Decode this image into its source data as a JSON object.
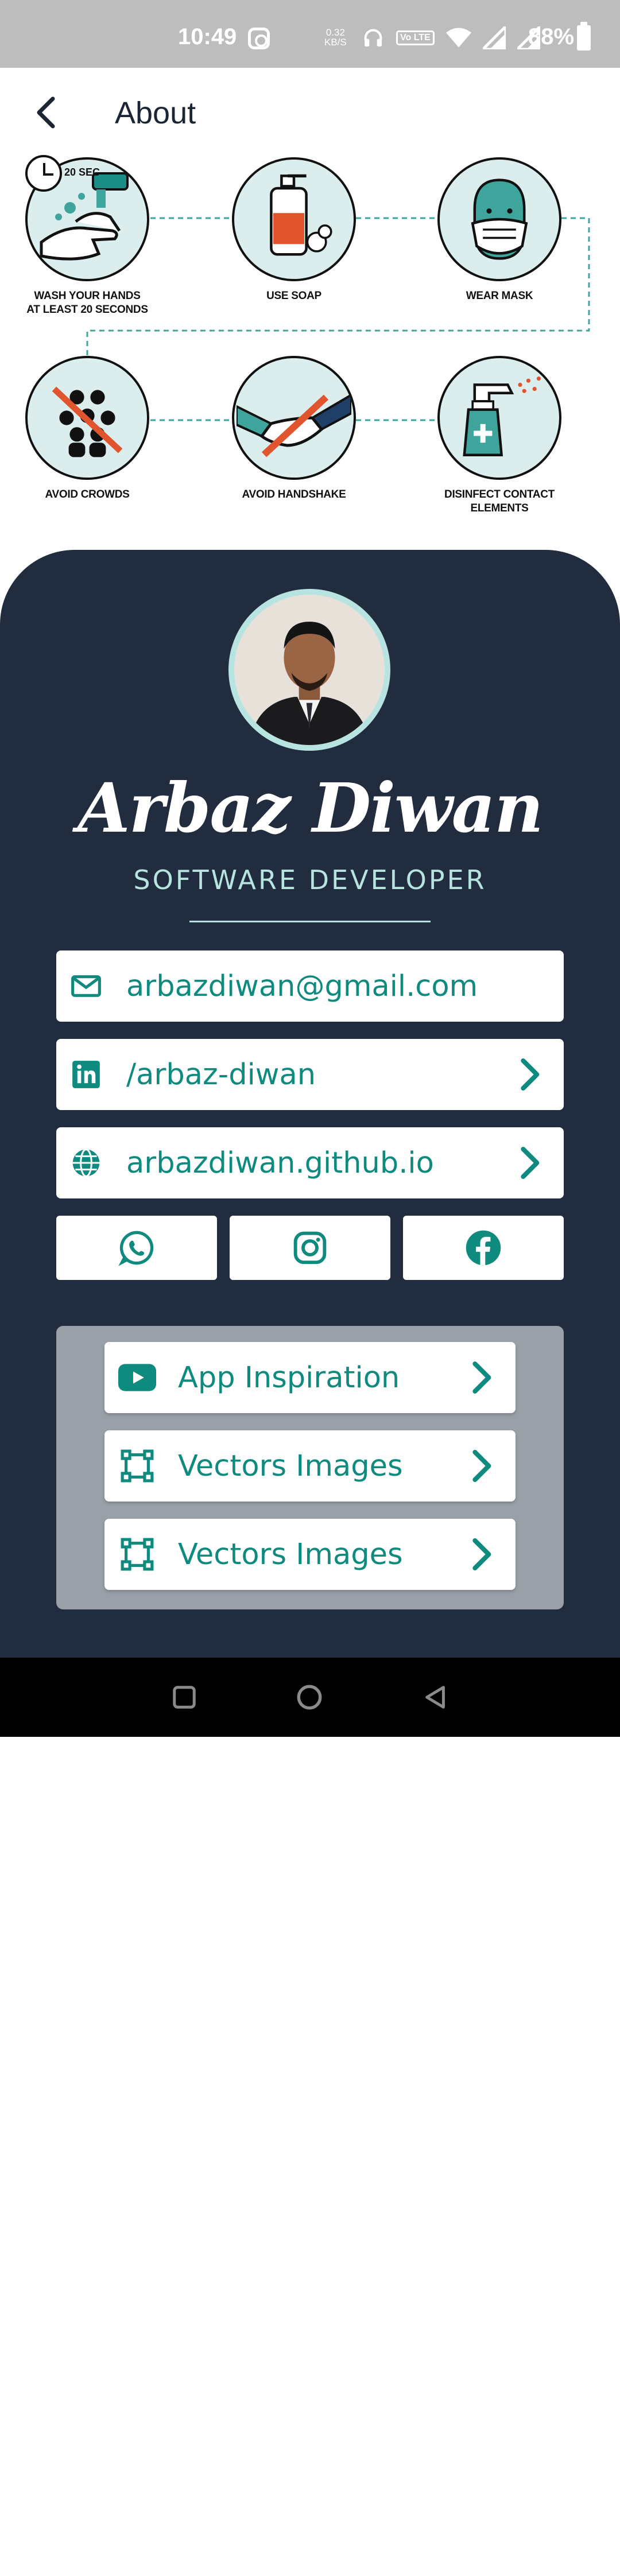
{
  "status_bar": {
    "time": "10:49",
    "net_speed_value": "0.32",
    "net_speed_unit": "KB/S",
    "volte_label": "Vo LTE",
    "battery": "88%",
    "icons": [
      "instagram-icon",
      "headphones-icon",
      "volte-icon",
      "wifi-icon",
      "signal-icon",
      "signal-icon",
      "battery-icon"
    ]
  },
  "app_bar": {
    "title": "About",
    "back_icon": "arrow-back-icon"
  },
  "hygiene": {
    "timer_label": "20 SEC",
    "items": [
      {
        "label": "WASH YOUR HANDS\nAT LEAST 20 SECONDS",
        "icon": "hand-wash-icon"
      },
      {
        "label": "USE SOAP",
        "icon": "soap-icon"
      },
      {
        "label": "WEAR MASK",
        "icon": "mask-icon"
      },
      {
        "label": "AVOID CROWDS",
        "icon": "crowd-icon"
      },
      {
        "label": "AVOID HANDSHAKE",
        "icon": "handshake-icon"
      },
      {
        "label": "DISINFECT CONTACT ELEMENTS",
        "icon": "spray-icon"
      }
    ]
  },
  "profile": {
    "name": "Arbaz Diwan",
    "role": "SOFTWARE DEVELOPER"
  },
  "contacts": [
    {
      "text": "arbazdiwan@gmail.com",
      "icon": "email-icon",
      "chevron": false
    },
    {
      "text": "/arbaz-diwan",
      "icon": "linkedin-icon",
      "chevron": true
    },
    {
      "text": "arbazdiwan.github.io",
      "icon": "globe-icon",
      "chevron": true
    }
  ],
  "socials": [
    "whatsapp-icon",
    "instagram-icon",
    "facebook-icon"
  ],
  "links": [
    {
      "text": "App Inspiration",
      "icon": "youtube-icon"
    },
    {
      "text": "Vectors Images",
      "icon": "vector-icon"
    },
    {
      "text": "Vectors Images",
      "icon": "vector-icon"
    }
  ],
  "nav": [
    "recents-icon",
    "home-icon",
    "back-icon"
  ],
  "colors": {
    "status_bar": "#bdbdbd",
    "card_bg": "#212c3e",
    "accent_teal": "#0f8a7e",
    "light_teal": "#b7e4e0",
    "panel_grey": "#9aa0a8",
    "title_dark": "#1c2534"
  }
}
